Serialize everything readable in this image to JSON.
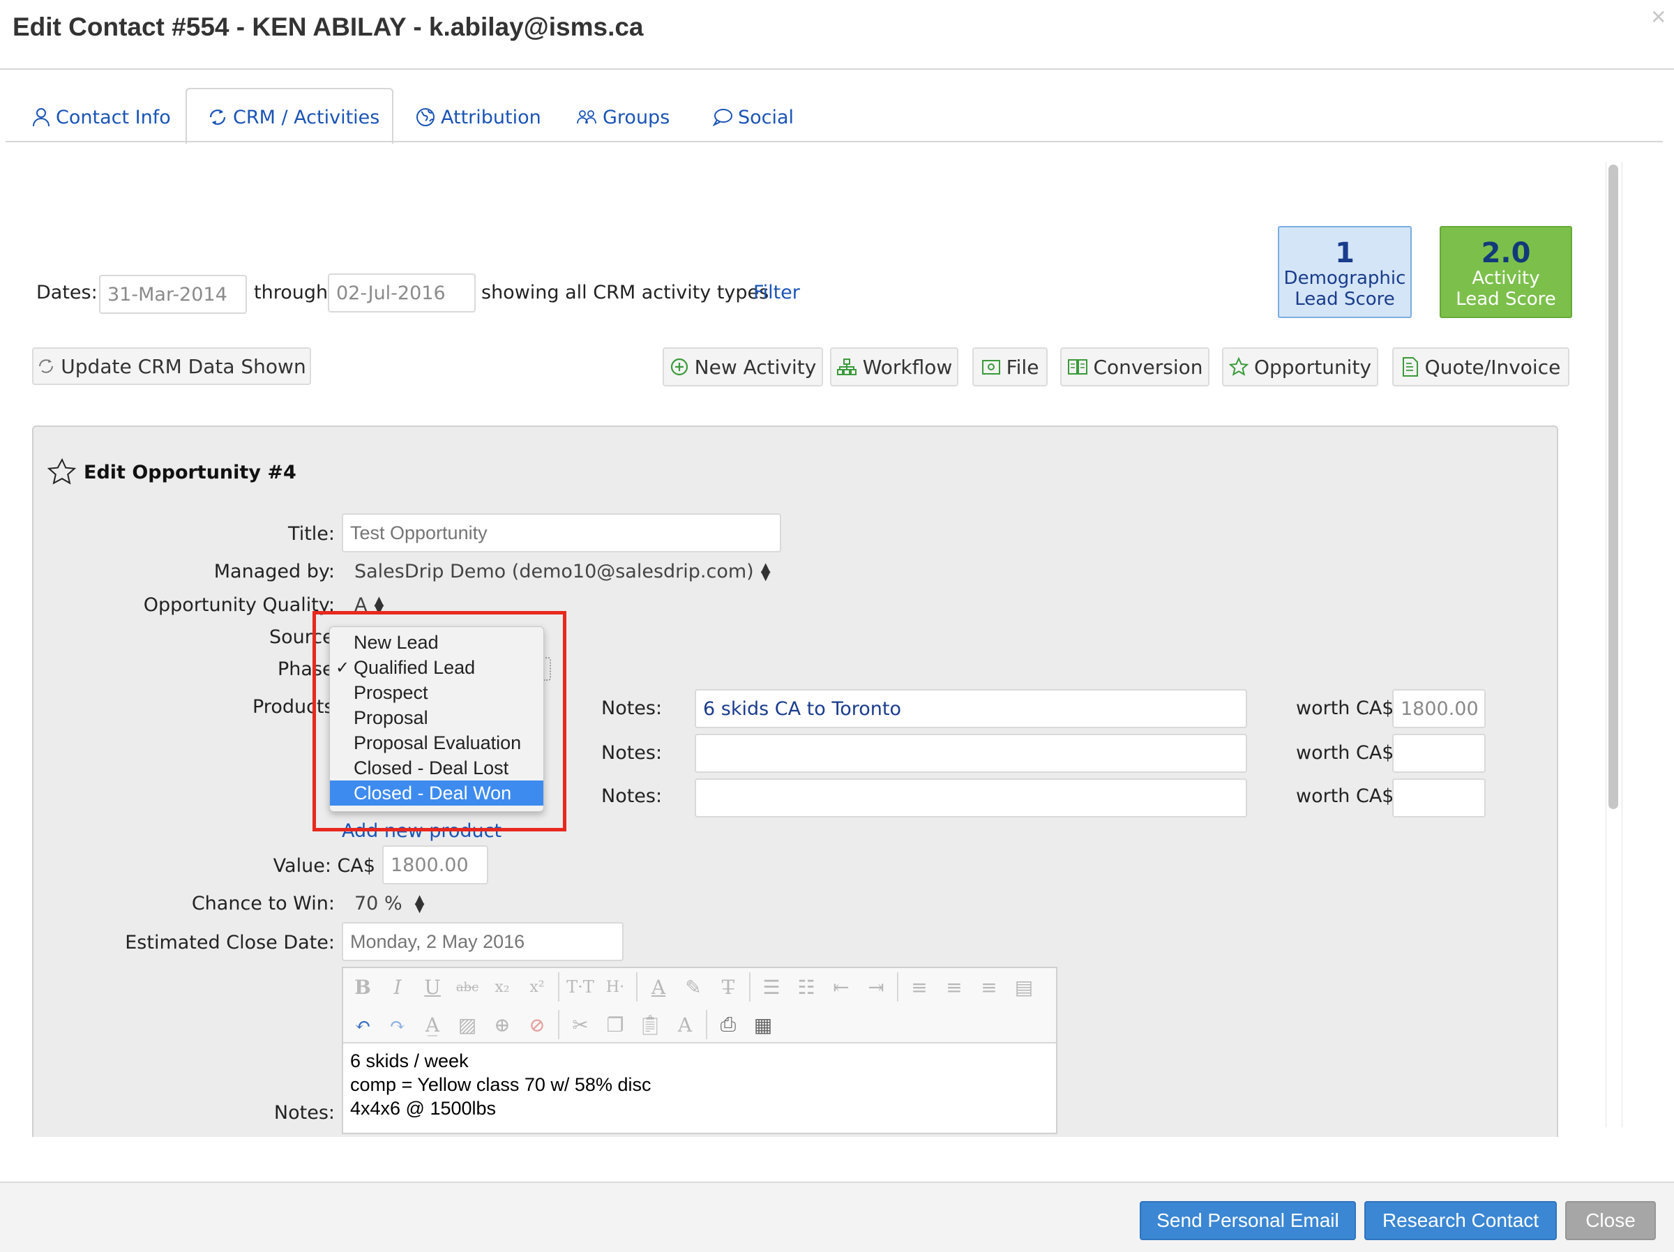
{
  "header": {
    "title": "Edit Contact #554 - KEN ABILAY - k.abilay@isms.ca"
  },
  "tabs": [
    {
      "label": "Contact Info",
      "icon": "person-icon",
      "active": false
    },
    {
      "label": "CRM / Activities",
      "icon": "refresh-icon",
      "active": true
    },
    {
      "label": "Attribution",
      "icon": "globe-icon",
      "active": false
    },
    {
      "label": "Groups",
      "icon": "group-icon",
      "active": false
    },
    {
      "label": "Social",
      "icon": "speech-bubble-icon",
      "active": false
    }
  ],
  "filters": {
    "dates_label": "Dates:",
    "start_date": "31-Mar-2014",
    "through_label": "through",
    "end_date": "02-Jul-2016",
    "showing_text": "showing all CRM activity types",
    "filter_link": "Filter"
  },
  "scores": {
    "demographic": {
      "value": "1",
      "line1": "Demographic",
      "line2": "Lead Score",
      "bg": "#d4e5f7",
      "color": "#1a3c8c"
    },
    "activity": {
      "value": "2.0",
      "line1": "Activity",
      "line2": "Lead Score",
      "bg": "#7cc04b",
      "color": "#ffffff",
      "value_color": "#123a7a"
    }
  },
  "toolbar": {
    "update_label": "Update CRM Data Shown",
    "actions": [
      "New Activity",
      "Workflow",
      "File",
      "Conversion",
      "Opportunity",
      "Quote/Invoice"
    ]
  },
  "opportunity": {
    "heading": "Edit Opportunity #4",
    "title_label": "Title:",
    "title_placeholder": "Test Opportunity",
    "managed_label": "Managed by:",
    "managed_value": "SalesDrip Demo (demo10@salesdrip.com)",
    "quality_label": "Opportunity Quality:",
    "quality_value": "A",
    "source_label": "Source",
    "phase_label": "Phase",
    "products_label": "Products",
    "add_product_link": "Add new product",
    "products": [
      {
        "notes_label": "Notes:",
        "notes": "6 skids CA to Toronto",
        "worth_label": "worth CA$",
        "worth": "1800.00"
      },
      {
        "notes_label": "Notes:",
        "notes": "",
        "worth_label": "worth CA$",
        "worth": ""
      },
      {
        "notes_label": "Notes:",
        "notes": "",
        "worth_label": "worth CA$",
        "worth": ""
      }
    ],
    "value_label": "Value: CA$",
    "value": "1800.00",
    "chance_label": "Chance to Win:",
    "chance_value": "70 %",
    "close_date_label": "Estimated Close Date:",
    "close_date_placeholder": "Monday, 2 May 2016",
    "notes_label": "Notes:",
    "notes_lines": [
      "6 skids / week",
      "comp = Yellow class 70 w/ 58% disc",
      "4x4x6 @ 1500lbs"
    ]
  },
  "phase_dropdown": {
    "options": [
      "New Lead",
      "Qualified Lead",
      "Prospect",
      "Proposal",
      "Proposal Evaluation",
      "Closed - Deal Lost",
      "Closed - Deal Won"
    ],
    "checked": "Qualified Lead",
    "highlighted": "Closed - Deal Won",
    "highlight_color": "#3d8bef",
    "callout_color": "#e8281e"
  },
  "footer": {
    "send_email": "Send Personal Email",
    "research": "Research Contact",
    "close": "Close",
    "primary_color": "#3b87d4",
    "close_color": "#a6a6a6"
  }
}
